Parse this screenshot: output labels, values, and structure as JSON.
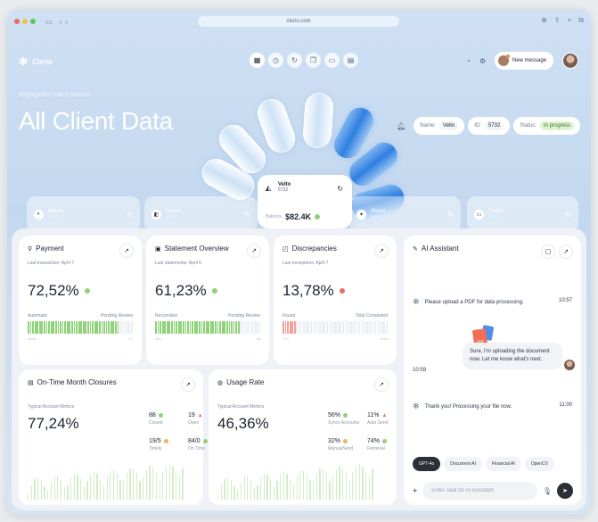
{
  "browser": {
    "url": "clerio.com"
  },
  "app": {
    "name": "Clerio",
    "new_message": "New message"
  },
  "hero": {
    "subtitle": "Aggregated Client Metrics",
    "title": "All Client Data"
  },
  "meta": {
    "name_label": "Name:",
    "name_value": "Velto",
    "id_label": "ID:",
    "id_value": "5732",
    "status_label": "Status:",
    "status_value": "In progress"
  },
  "clients": [
    {
      "name": "Braym",
      "id": "1293"
    },
    {
      "name": "Nomix",
      "id": "8155"
    },
    {
      "name": "Skivor",
      "id": "9864"
    },
    {
      "name": "Trellon",
      "id": "4423"
    }
  ],
  "selected_client": {
    "name": "Velto",
    "id": "5732",
    "balance_label": "Balance",
    "balance": "$82.4K"
  },
  "payment": {
    "title": "Payment",
    "sub": "Last transaction: April 7",
    "value": "72,52%",
    "left": "Automatic",
    "right": "Pending Review",
    "bl": "152K",
    "br": "17",
    "fill": 0.86
  },
  "statement": {
    "title": "Statement Overview",
    "sub": "Last statements: April 6",
    "value": "61,23%",
    "left": "Reconciled",
    "right": "Pending Review",
    "bl": "189",
    "br": "24",
    "fill": 0.8
  },
  "discrepancies": {
    "title": "Discrepancies",
    "sub": "Last exceptions: April 7",
    "value": "13,78%",
    "left": "Found",
    "right": "Total Completed",
    "bl": "179",
    "br": "1120",
    "fill": 0.12
  },
  "closures": {
    "title": "On-Time Month Closures",
    "sub": "Typical Account Metrics",
    "value": "77,24%",
    "stats": [
      {
        "value": "88",
        "label": "Closed",
        "status": "green"
      },
      {
        "value": "19",
        "label": "Open",
        "status": "red"
      },
      {
        "value": "19/5",
        "label": "Timely",
        "status": "orange"
      },
      {
        "value": "84/0",
        "label": "On Time",
        "status": "green"
      }
    ]
  },
  "usage": {
    "title": "Usage Rate",
    "sub": "Typical Account Metrics",
    "value": "46,36%",
    "stats": [
      {
        "value": "56%",
        "label": "Syncs Accounts",
        "status": "green"
      },
      {
        "value": "11%",
        "label": "Auto Send",
        "status": "red"
      },
      {
        "value": "32%",
        "label": "ManualSend",
        "status": "orange"
      },
      {
        "value": "74%",
        "label": "Retrieval",
        "status": "green"
      }
    ]
  },
  "assistant": {
    "title": "AI Assistant",
    "messages": [
      {
        "text": "Please upload a PDF for data processing.",
        "time": "10:57"
      },
      {
        "text": "Sure, I'm uploading the document now. Let me know what's next.",
        "time": "10:59"
      },
      {
        "text": "Thank you! Processing your file now.",
        "time": "11:00"
      }
    ],
    "models": [
      "GPT-4o",
      "Document AI",
      "Financial AI",
      "OpenCV"
    ],
    "input_placeholder": "Enter Task for AI Assistant"
  },
  "colors": {
    "green": "#8fd27a",
    "red": "#ee6a5f",
    "orange": "#f5b45a",
    "accent": "#2b2f36"
  }
}
